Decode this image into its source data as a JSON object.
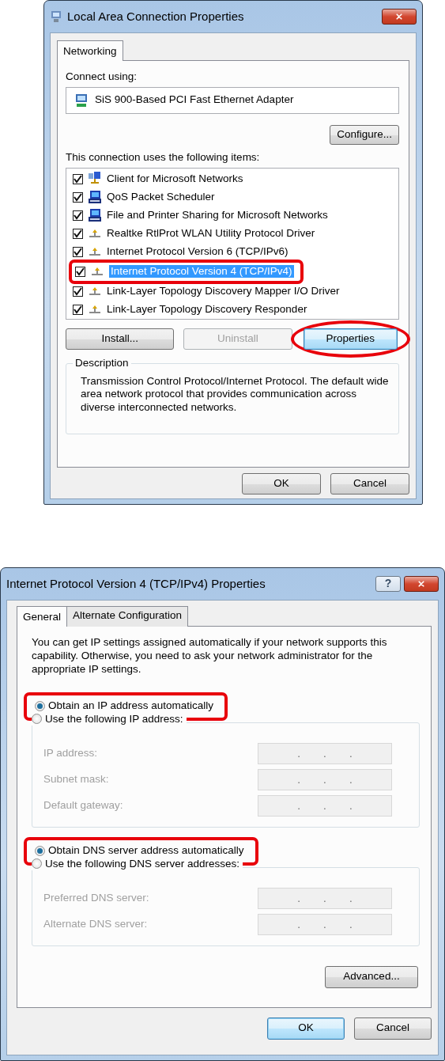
{
  "connection_dialog": {
    "title": "Local Area Connection Properties",
    "tabs": [
      {
        "label": "Networking",
        "selected": true
      }
    ],
    "connect_label": "Connect using:",
    "adapter": "SiS 900-Based PCI Fast Ethernet Adapter",
    "configure_button": "Configure...",
    "items_label": "This connection uses the following items:",
    "items": [
      {
        "label": "Client for Microsoft Networks",
        "kind": "client",
        "checked": true,
        "selected": false,
        "highlighted": false
      },
      {
        "label": "QoS Packet Scheduler",
        "kind": "computer",
        "checked": true,
        "selected": false,
        "highlighted": false
      },
      {
        "label": "File and Printer Sharing for Microsoft Networks",
        "kind": "computer",
        "checked": true,
        "selected": false,
        "highlighted": false
      },
      {
        "label": "Realtke RtlProt WLAN Utility Protocol Driver",
        "kind": "protocol",
        "checked": true,
        "selected": false,
        "highlighted": false
      },
      {
        "label": "Internet Protocol Version 6 (TCP/IPv6)",
        "kind": "protocol",
        "checked": true,
        "selected": false,
        "highlighted": false
      },
      {
        "label": "Internet Protocol Version 4 (TCP/IPv4)",
        "kind": "protocol",
        "checked": true,
        "selected": true,
        "highlighted": true
      },
      {
        "label": "Link-Layer Topology Discovery Mapper I/O Driver",
        "kind": "protocol",
        "checked": true,
        "selected": false,
        "highlighted": false
      },
      {
        "label": "Link-Layer Topology Discovery Responder",
        "kind": "protocol",
        "checked": true,
        "selected": false,
        "highlighted": false
      }
    ],
    "buttons": [
      {
        "label": "Install...",
        "disabled": false,
        "focused": false,
        "circled": false
      },
      {
        "label": "Uninstall",
        "disabled": true,
        "focused": false,
        "circled": false
      },
      {
        "label": "Properties",
        "disabled": false,
        "focused": true,
        "circled": true
      }
    ],
    "description": {
      "legend": "Description",
      "text": "Transmission Control Protocol/Internet Protocol. The default wide area network protocol that provides communication across diverse interconnected networks."
    },
    "footer": [
      {
        "label": "OK",
        "focused": false
      },
      {
        "label": "Cancel",
        "focused": false
      }
    ]
  },
  "ipv4_dialog": {
    "title": "Internet Protocol Version 4 (TCP/IPv4) Properties",
    "help_glyph": "?",
    "tabs": [
      {
        "label": "General",
        "selected": true
      },
      {
        "label": "Alternate Configuration",
        "selected": false
      }
    ],
    "intro": "You can get IP settings assigned automatically if your network supports this capability. Otherwise, you need to ask your network administrator for the appropriate IP settings.",
    "separator": ".",
    "ip_options": [
      {
        "label": "Obtain an IP address automatically",
        "selected": true,
        "highlighted": true
      },
      {
        "label": "Use the following IP address:",
        "selected": false,
        "highlighted": false
      }
    ],
    "ip_fields": [
      {
        "label": "IP address:",
        "disabled": true
      },
      {
        "label": "Subnet mask:",
        "disabled": true
      },
      {
        "label": "Default gateway:",
        "disabled": true
      }
    ],
    "dns_options": [
      {
        "label": "Obtain DNS server address automatically",
        "selected": true,
        "highlighted": true
      },
      {
        "label": "Use the following DNS server addresses:",
        "selected": false,
        "highlighted": false
      }
    ],
    "dns_fields": [
      {
        "label": "Preferred DNS server:",
        "disabled": true
      },
      {
        "label": "Alternate DNS server:",
        "disabled": true
      }
    ],
    "advanced_button": "Advanced...",
    "footer": [
      {
        "label": "OK",
        "focused": true
      },
      {
        "label": "Cancel",
        "focused": false
      }
    ]
  }
}
